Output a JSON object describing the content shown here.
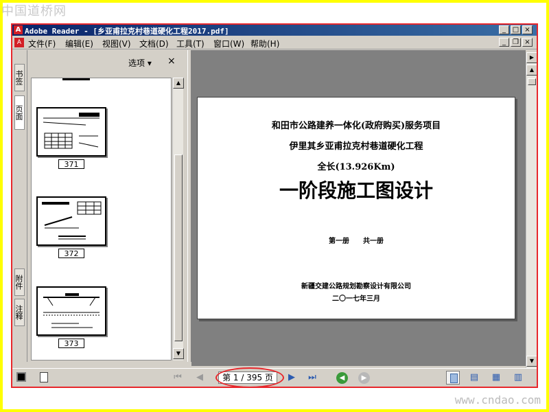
{
  "watermark_top": "中国道桥网",
  "watermark_bottom": "www.cndao.com",
  "window": {
    "title": "Adobe Reader - [乡亚甫拉克村巷道硬化工程2017.pdf]",
    "icon": "adobe-reader-icon"
  },
  "menu": {
    "file": "文件(F)",
    "edit": "编辑(E)",
    "view": "视图(V)",
    "document": "文档(D)",
    "tools": "工具(T)",
    "window": "窗口(W)",
    "help": "帮助(H)"
  },
  "side_tabs": {
    "bookmarks": "书签",
    "pages": "页面",
    "attachments": "附件",
    "comments": "注释"
  },
  "thumb_pane": {
    "options_label": "选项 ▾",
    "close_label": "×",
    "pages": [
      {
        "label": "371"
      },
      {
        "label": "372"
      },
      {
        "label": "373"
      }
    ]
  },
  "document": {
    "line1": "和田市公路建养一体化(政府购买)服务项目",
    "line2": "伊里其乡亚甫拉克村巷道硬化工程",
    "line3": "全长(13.926Km)",
    "main_title": "一阶段施工图设计",
    "volume": "第一册　　共一册",
    "company": "新疆交建公路规划勘察设计有限公司",
    "date": "二〇一七年三月"
  },
  "status": {
    "page_indicator": "第 1 / 395 页",
    "current_page": 1,
    "total_pages": 395
  },
  "colors": {
    "frame": "#ffff00",
    "window_border": "#e8262b",
    "highlight_ellipse": "#e8262b",
    "title_bar": "#0a246a",
    "nav_green": "#3a9a3a"
  }
}
